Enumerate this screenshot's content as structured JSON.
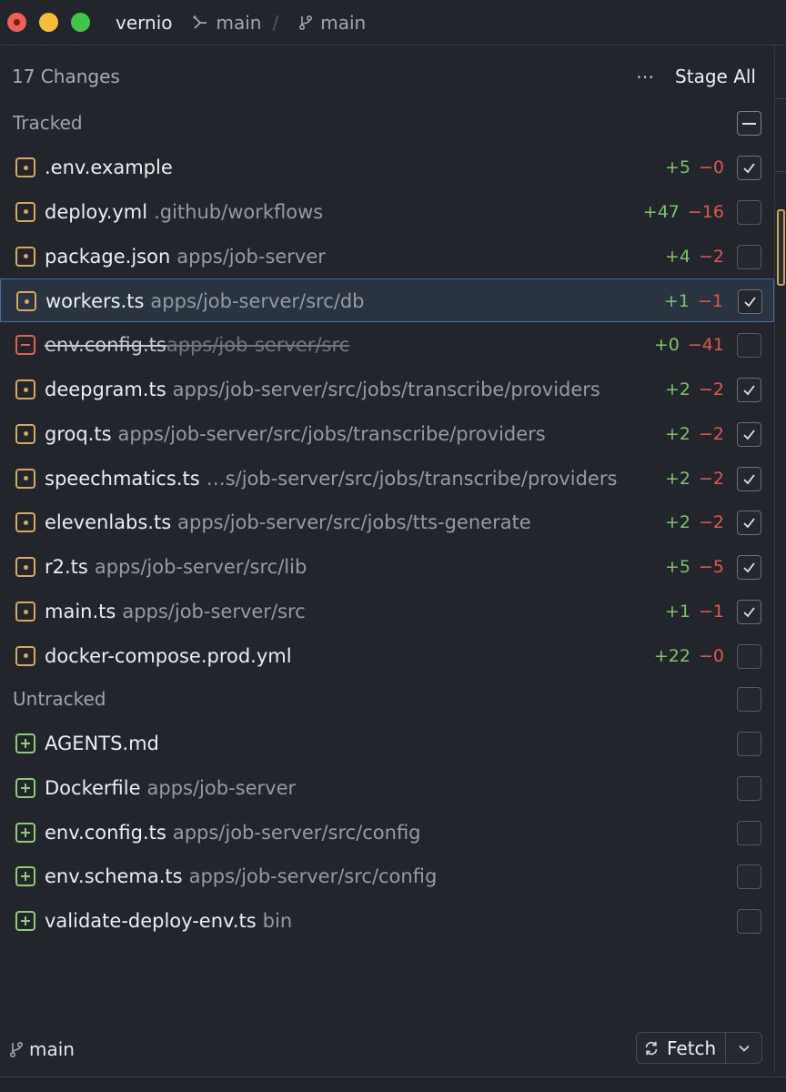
{
  "titlebar": {
    "repo": "vernio",
    "crumb1": "main",
    "separator": "/",
    "crumb2": "main"
  },
  "changes": {
    "count_label": "17 Changes",
    "more_icon": "ellipsis-icon",
    "stage_all": "Stage All"
  },
  "sections": {
    "tracked": "Tracked",
    "untracked": "Untracked"
  },
  "tracked_files": [
    {
      "name": ".env.example",
      "path": "",
      "added": "+5",
      "removed": "−0",
      "status": "modified",
      "checked": true
    },
    {
      "name": "deploy.yml",
      "path": ".github/workflows",
      "added": "+47",
      "removed": "−16",
      "status": "modified",
      "checked": false
    },
    {
      "name": "package.json",
      "path": "apps/job-server",
      "added": "+4",
      "removed": "−2",
      "status": "modified",
      "checked": false
    },
    {
      "name": "workers.ts",
      "path": "apps/job-server/src/db",
      "added": "+1",
      "removed": "−1",
      "status": "modified",
      "checked": true,
      "selected": true
    },
    {
      "name": "env.config.ts",
      "path": "apps/job-server/src",
      "added": "+0",
      "removed": "−41",
      "status": "deleted",
      "checked": false
    },
    {
      "name": "deepgram.ts",
      "path": "apps/job-server/src/jobs/transcribe/providers",
      "added": "+2",
      "removed": "−2",
      "status": "modified",
      "checked": true
    },
    {
      "name": "groq.ts",
      "path": "apps/job-server/src/jobs/transcribe/providers",
      "added": "+2",
      "removed": "−2",
      "status": "modified",
      "checked": true
    },
    {
      "name": "speechmatics.ts",
      "path": "…s/job-server/src/jobs/transcribe/providers",
      "added": "+2",
      "removed": "−2",
      "status": "modified",
      "checked": true
    },
    {
      "name": "elevenlabs.ts",
      "path": "apps/job-server/src/jobs/tts-generate",
      "added": "+2",
      "removed": "−2",
      "status": "modified",
      "checked": true
    },
    {
      "name": "r2.ts",
      "path": "apps/job-server/src/lib",
      "added": "+5",
      "removed": "−5",
      "status": "modified",
      "checked": true
    },
    {
      "name": "main.ts",
      "path": "apps/job-server/src",
      "added": "+1",
      "removed": "−1",
      "status": "modified",
      "checked": true
    },
    {
      "name": "docker-compose.prod.yml",
      "path": "",
      "added": "+22",
      "removed": "−0",
      "status": "modified",
      "checked": false
    }
  ],
  "untracked_files": [
    {
      "name": "AGENTS.md",
      "path": "",
      "status": "added",
      "checked": false
    },
    {
      "name": "Dockerfile",
      "path": "apps/job-server",
      "status": "added",
      "checked": false
    },
    {
      "name": "env.config.ts",
      "path": "apps/job-server/src/config",
      "status": "added",
      "checked": false
    },
    {
      "name": "env.schema.ts",
      "path": "apps/job-server/src/config",
      "status": "added",
      "checked": false
    },
    {
      "name": "validate-deploy-env.ts",
      "path": "bin",
      "status": "added",
      "checked": false
    }
  ],
  "footer": {
    "branch": "main",
    "fetch_label": "Fetch",
    "fetch_icon": "refresh-icon",
    "caret_icon": "chevron-down-icon"
  },
  "colors": {
    "background": "#22252c",
    "modified": "#d8a85c",
    "deleted": "#e0605a",
    "added_status": "#8fcc73",
    "additions": "#7ec36b",
    "deletions": "#e1574d",
    "selection_border": "#3f6da8"
  }
}
